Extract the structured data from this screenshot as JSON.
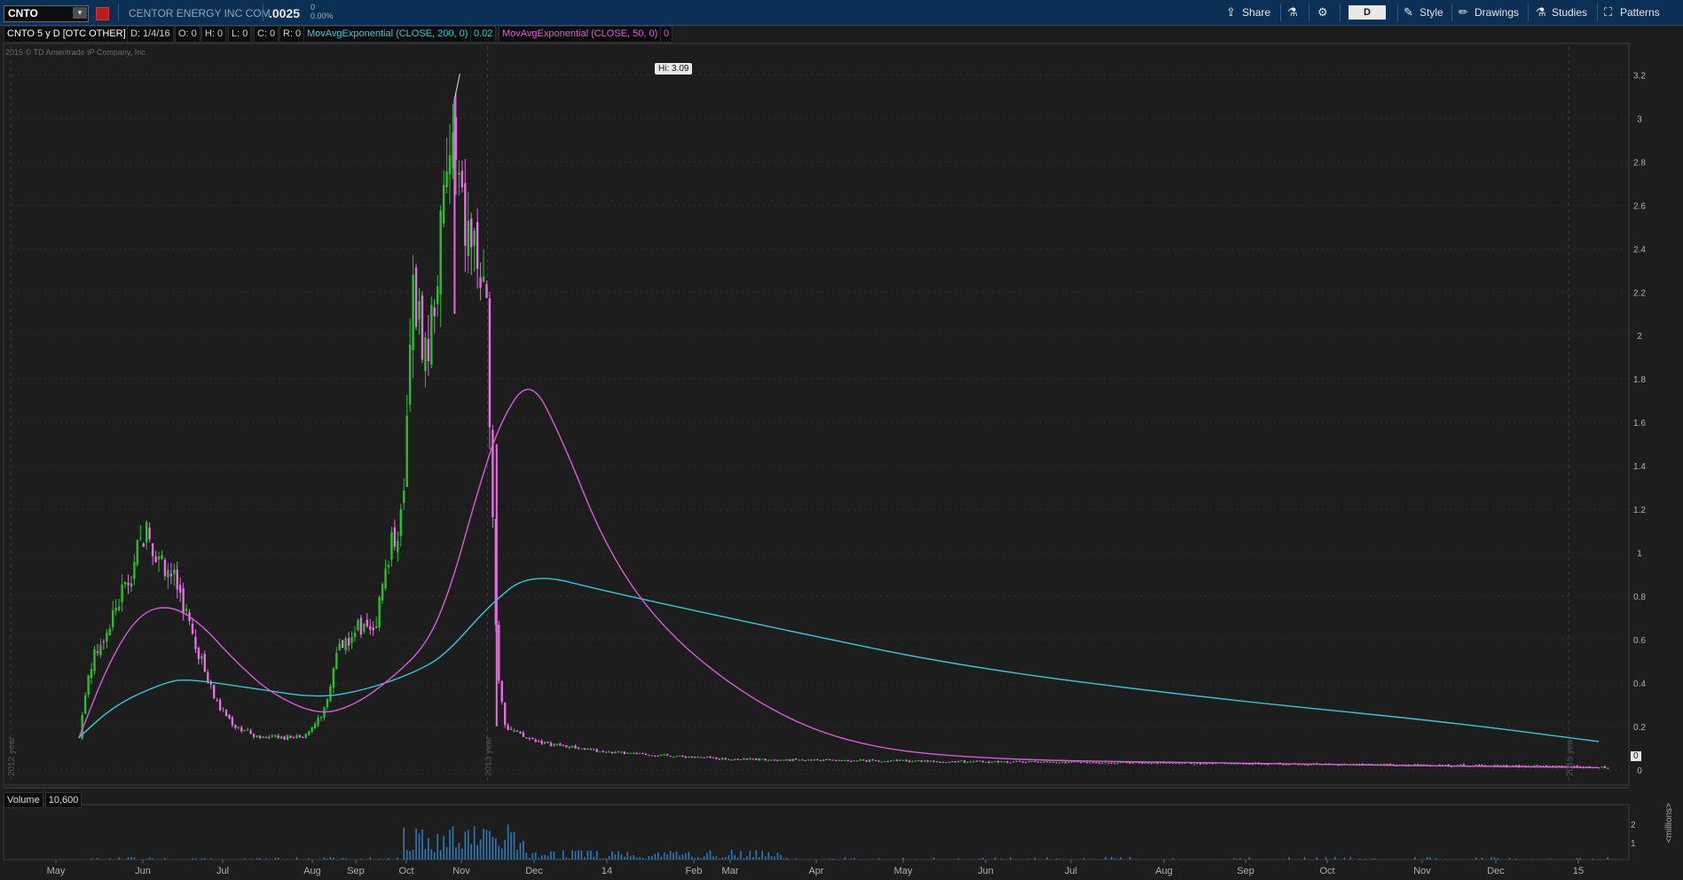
{
  "header": {
    "symbol": "CNTO",
    "company": "CENTOR ENERGY INC COM",
    "price": ".0025",
    "change": "0",
    "change_pct": "0.00%",
    "share_label": "Share",
    "aggregation": "D",
    "style_label": "Style",
    "drawings_label": "Drawings",
    "studies_label": "Studies",
    "patterns_label": "Patterns"
  },
  "info": {
    "title": "CNTO 5 y D [OTC OTHER]",
    "date": "D: 1/4/16",
    "open": "O: 0",
    "high": "H: 0",
    "low": "L: 0",
    "close": "C: 0",
    "range": "R: 0",
    "ema200_label": "MovAvgExponential (CLOSE, 200, 0)",
    "ema200_value": "0.02",
    "ema50_label": "MovAvgExponential (CLOSE, 50, 0)",
    "ema50_value": "0",
    "copyright": "2015 © TD Ameritrade IP Company, Inc."
  },
  "annotations": {
    "hi_label": "Hi: 3.09",
    "current_label": "0"
  },
  "year_markers": [
    "2012 year",
    "2013 year",
    "2015 year"
  ],
  "volume": {
    "label": "Volume",
    "value": "10,600",
    "unit": "<millions>",
    "ticks": [
      "2",
      "1"
    ]
  },
  "colors": {
    "up_candle": "#2dbd2d",
    "down_candle": "#e56ee5",
    "ema200": "#3ec6d6",
    "ema50": "#d85fd8",
    "volume_bar": "#2f78b8",
    "background": "#1d1d1d",
    "header": "#0c2f55"
  },
  "chart_data": {
    "type": "candlestick",
    "y_ticks": [
      3.2,
      3,
      2.8,
      2.6,
      2.4,
      2.2,
      2,
      1.8,
      1.6,
      1.4,
      1.2,
      1,
      0.8,
      0.6,
      0.4,
      0.2,
      0
    ],
    "y_range": [
      -0.05,
      3.3
    ],
    "x_ticks": [
      "May",
      "Jun",
      "Jul",
      "Aug",
      "Sep",
      "Oct",
      "Nov",
      "Dec",
      "14",
      "Feb",
      "Mar",
      "Apr",
      "May",
      "Jun",
      "Jul",
      "Aug",
      "Sep",
      "Oct",
      "Nov",
      "Dec",
      "15"
    ],
    "high": 3.09,
    "series": [
      {
        "name": "MovAvgExponential (CLOSE, 200, 0)",
        "points": [
          [
            0.12,
            0.15
          ],
          [
            0.18,
            0.3
          ],
          [
            0.26,
            0.4
          ],
          [
            0.3,
            0.42
          ],
          [
            0.42,
            0.37
          ],
          [
            0.52,
            0.33
          ],
          [
            0.6,
            0.37
          ],
          [
            0.68,
            0.45
          ],
          [
            0.73,
            0.53
          ],
          [
            0.8,
            0.75
          ],
          [
            0.87,
            0.91
          ],
          [
            1.0,
            0.82
          ],
          [
            1.3,
            0.64
          ],
          [
            1.6,
            0.47
          ],
          [
            2.0,
            0.33
          ],
          [
            2.4,
            0.22
          ],
          [
            2.65,
            0.13
          ]
        ]
      },
      {
        "name": "MovAvgExponential (CLOSE, 50, 0)",
        "points": [
          [
            0.12,
            0.15
          ],
          [
            0.17,
            0.5
          ],
          [
            0.22,
            0.72
          ],
          [
            0.27,
            0.76
          ],
          [
            0.32,
            0.68
          ],
          [
            0.38,
            0.5
          ],
          [
            0.44,
            0.35
          ],
          [
            0.52,
            0.25
          ],
          [
            0.58,
            0.3
          ],
          [
            0.64,
            0.42
          ],
          [
            0.7,
            0.58
          ],
          [
            0.74,
            0.85
          ],
          [
            0.78,
            1.25
          ],
          [
            0.82,
            1.6
          ],
          [
            0.87,
            1.81
          ],
          [
            0.92,
            1.55
          ],
          [
            1.0,
            1.0
          ],
          [
            1.1,
            0.62
          ],
          [
            1.25,
            0.3
          ],
          [
            1.4,
            0.12
          ],
          [
            1.6,
            0.05
          ],
          [
            2.0,
            0.03
          ],
          [
            2.65,
            0.01
          ]
        ]
      }
    ]
  }
}
